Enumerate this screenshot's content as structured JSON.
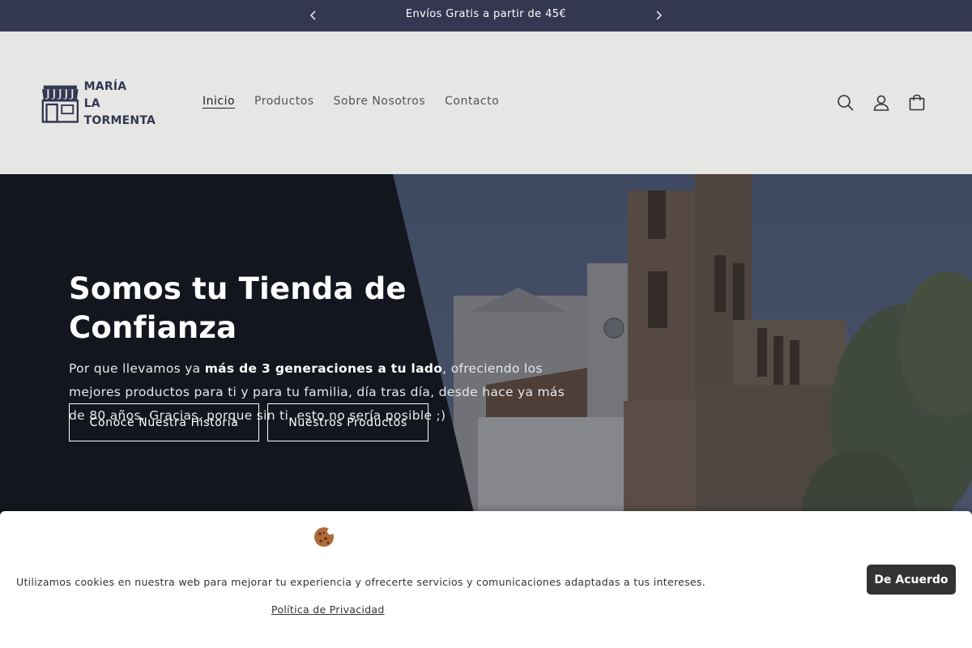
{
  "announcement": {
    "message": "Envíos Gratis a partir de 45€",
    "prev_icon": "chevron-left-icon",
    "next_icon": "chevron-right-icon"
  },
  "header": {
    "logo_line1": "MARÍA",
    "logo_line2": "LA TORMENTA",
    "nav": [
      {
        "label": "Inicio",
        "active": true
      },
      {
        "label": "Productos",
        "active": false
      },
      {
        "label": "Sobre Nosotros",
        "active": false
      },
      {
        "label": "Contacto",
        "active": false
      }
    ],
    "icons": [
      "search-icon",
      "account-icon",
      "cart-icon"
    ]
  },
  "hero": {
    "title": "Somos tu Tienda de Confianza",
    "text_before": "Por que llevamos ya ",
    "text_bold": "más de 3 generaciones a tu lado",
    "text_after": ", ofreciendo los mejores productos para ti y para tu familia, día tras día, desde hace ya más de 80 años. Gracias, porque sin ti, esto no sería posible ;)",
    "buttons": [
      {
        "label": "Conoce Nuestra Historia"
      },
      {
        "label": "Nuestros Productos"
      }
    ]
  },
  "cookie_banner": {
    "icon": "cookie-icon",
    "text": "Utilizamos cookies en nuestra web para mejorar tu experiencia y ofrecerte servicios y comunicaciones adaptadas a tus intereses.",
    "policy_link": "Política de Privacidad",
    "accept_button": "De Acuerdo"
  },
  "colors": {
    "announcement_bg": "#333752",
    "header_bg": "#e6e7e4",
    "brand": "#333752",
    "cookie_button": "#333333"
  }
}
